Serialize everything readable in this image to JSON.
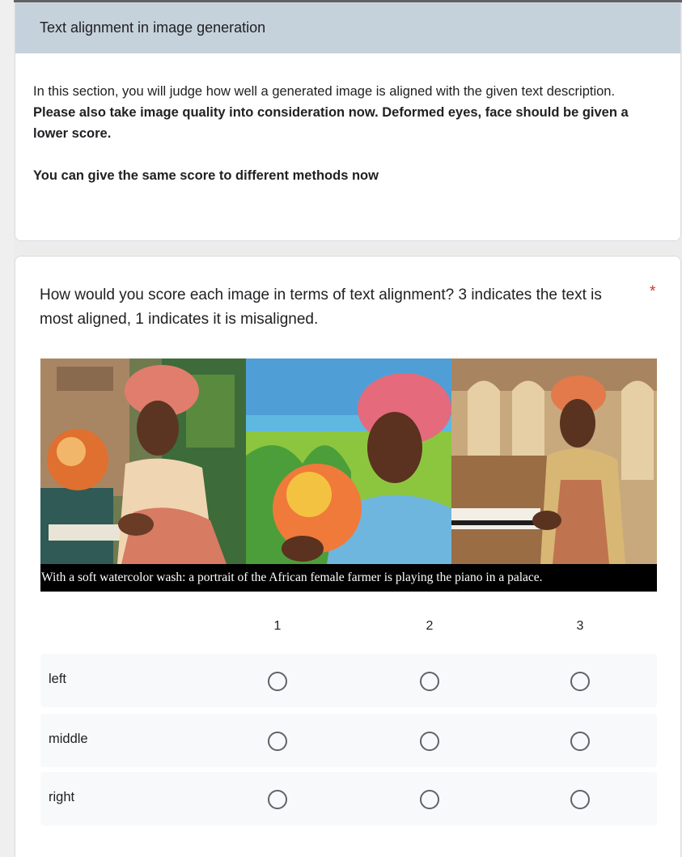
{
  "section": {
    "title": "Text alignment in image generation",
    "description": "In this section, you will judge how well a generated image is aligned with the given text description.",
    "note_bold_1": "Please also take image quality into consideration now. Deformed eyes, face should be given a lower score.",
    "note_bold_2": "You can give the same score to different methods now"
  },
  "question": {
    "title": "How would you score each image in terms of text alignment? 3 indicates the text is most aligned, 1 indicates it is misaligned.",
    "required_marker": "*",
    "image_caption": "With a soft watercolor wash: a portrait of the African female farmer is playing the piano in a palace.",
    "columns": [
      "1",
      "2",
      "3"
    ],
    "rows": [
      "left",
      "middle",
      "right"
    ]
  },
  "colors": {
    "header_bg": "#c5d1db",
    "required": "#d93025",
    "row_bg": "#f8f9fa"
  }
}
